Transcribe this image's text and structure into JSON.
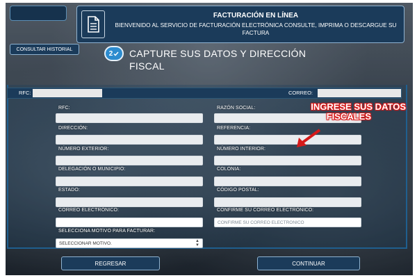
{
  "header": {
    "title": "FACTURACIÓN EN LÍNEA",
    "subtitle": "BIENVENIDO AL SERVICIO DE FACTURACIÓN ELECTRÓNICA CONSULTE, IMPRIMA O DESCARGUE SU FACTURA",
    "icon": "document-icon"
  },
  "history_button": "CONSULTAR HISTORIAL",
  "step": {
    "number": "2",
    "title": "CAPTURE SUS DATOS Y DIRECCIÓN FISCAL"
  },
  "summary_bar": {
    "rfc_label": "RFC:",
    "correo_label": "CORREO:"
  },
  "form": {
    "rfc_label": "RFC:",
    "razon_social_label": "RAZÓN SOCIAL:",
    "direccion_label": "DIRECCIÓN:",
    "referencia_label": "REFERENCIA:",
    "numero_exterior_label": "NÚMERO EXTERIOR:",
    "numero_interior_label": "NÚMERO INTERIOR:",
    "delegacion_label": "DELEGACIÓN O MUNICIPIO:",
    "colonia_label": "COLONIA:",
    "estado_label": "ESTADO:",
    "codigo_postal_label": "CÓDIGO POSTAL:",
    "correo_label": "CORREO ELECTRÓNICO:",
    "confirme_correo_label": "CONFIRME SU CORREO ELECTRÓNICO:",
    "confirme_correo_placeholder": "CONFIRME SU CORREO ELECTRÓNICO",
    "motivo_label": "SELECCIONA MOTIVO PARA FACTURAR:",
    "motivo_selected": "SELECCIONAR MOTIVO."
  },
  "annotation": {
    "text_line1": "INGRESE SUS DATOS",
    "text_line2": "FISCALES",
    "color": "#d61a1a"
  },
  "buttons": {
    "back": "REGRESAR",
    "continue": "CONTINUAR"
  },
  "colors": {
    "panel_blue": "#1b3b5a",
    "accent_blue": "#2d8ccf"
  }
}
